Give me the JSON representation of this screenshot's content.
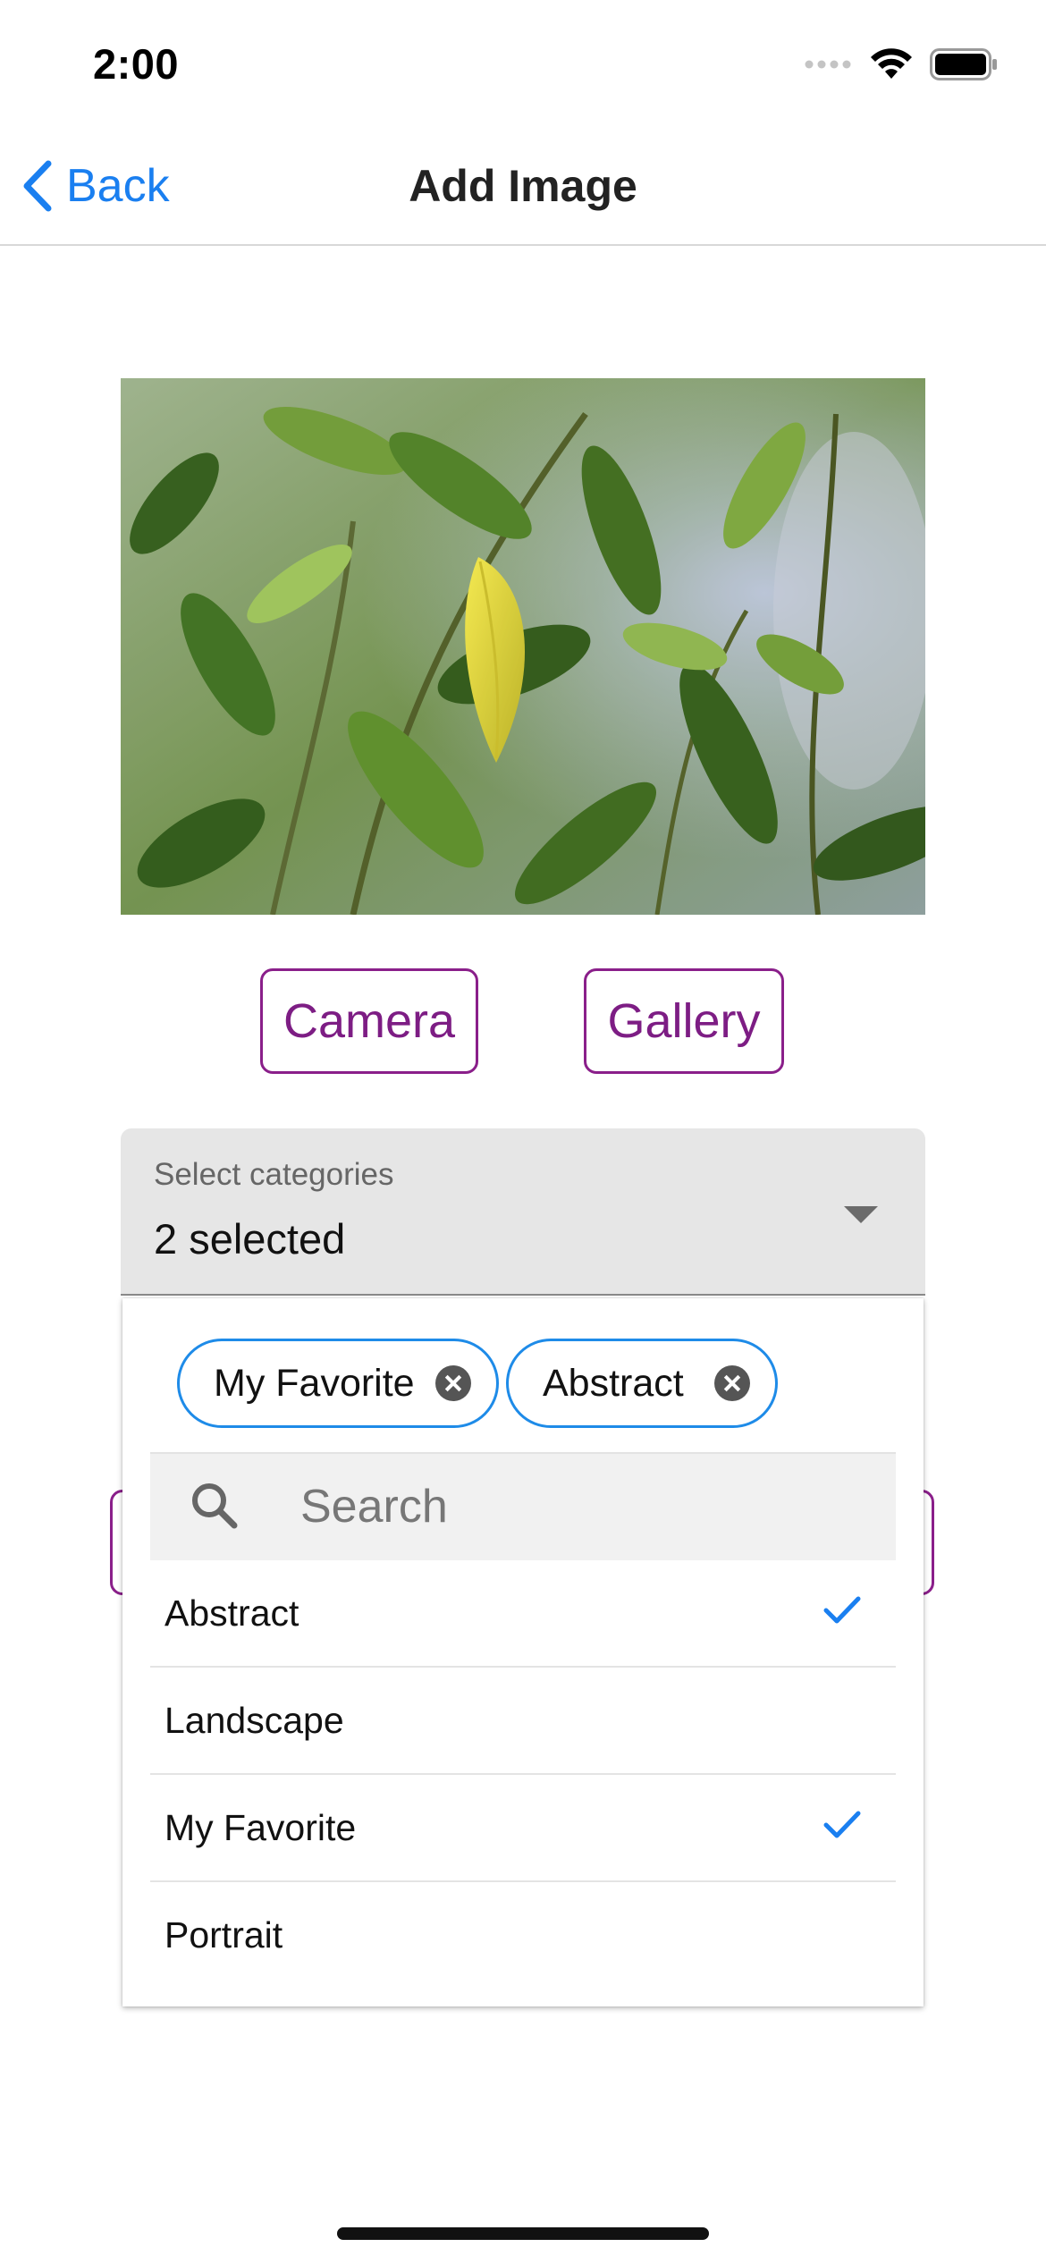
{
  "status_bar": {
    "time": "2:00",
    "icons": [
      "signal-icon",
      "wifi-icon",
      "battery-icon"
    ]
  },
  "nav": {
    "back_label": "Back",
    "title": "Add Image"
  },
  "photo": {
    "description_icon": "leaf-photo"
  },
  "buttons": {
    "camera": "Camera",
    "gallery": "Gallery"
  },
  "select": {
    "label": "Select categories",
    "value": "2 selected"
  },
  "chips": [
    {
      "label": "My Favorite"
    },
    {
      "label": "Abstract"
    }
  ],
  "search": {
    "placeholder": "Search",
    "value": ""
  },
  "options": [
    {
      "label": "Abstract",
      "checked": true
    },
    {
      "label": "Landscape",
      "checked": false
    },
    {
      "label": "My Favorite",
      "checked": true
    },
    {
      "label": "Portrait",
      "checked": false
    }
  ],
  "colors": {
    "accent_blue": "#1a7ff0",
    "button_purple": "#7d1d84",
    "chip_border": "#1e8be8"
  }
}
